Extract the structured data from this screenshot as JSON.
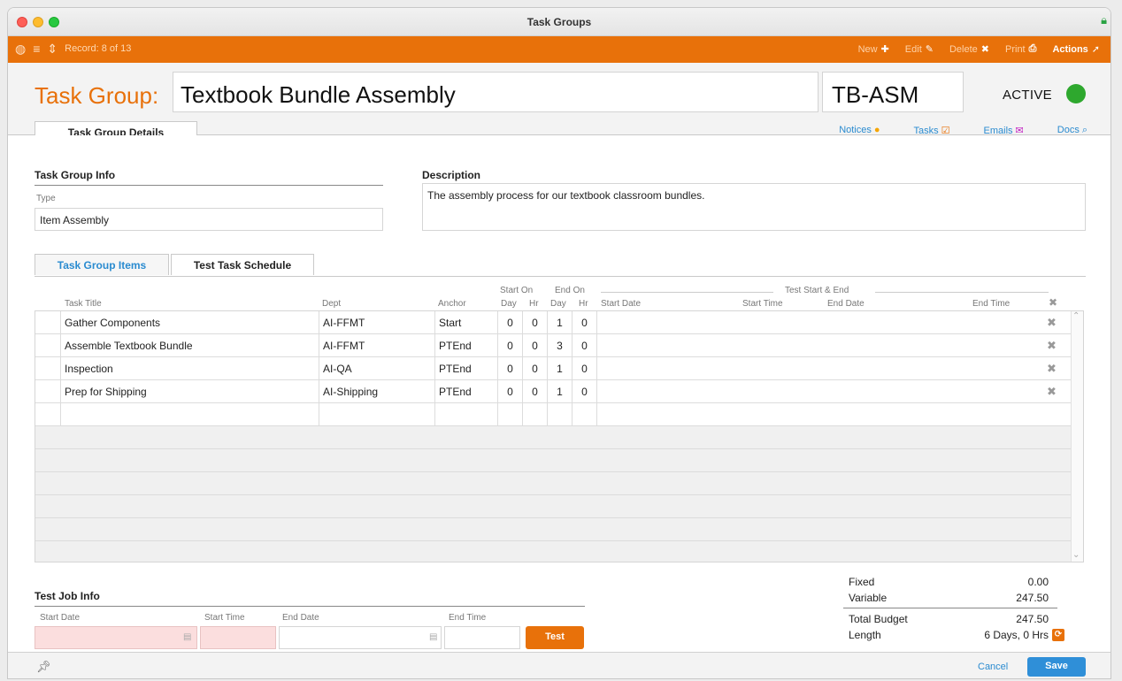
{
  "window": {
    "title": "Task Groups"
  },
  "toolbar": {
    "record": "Record: 8 of 13",
    "new_label": "New",
    "edit_label": "Edit",
    "delete_label": "Delete",
    "print_label": "Print",
    "actions_label": "Actions"
  },
  "header": {
    "label": "Task Group:",
    "name": "Textbook Bundle Assembly",
    "code": "TB-ASM",
    "status": "ACTIVE",
    "status_color": "#2ea82e",
    "main_tab": "Task Group Details",
    "links": {
      "notices": "Notices",
      "tasks": "Tasks",
      "emails": "Emails",
      "docs": "Docs"
    }
  },
  "info": {
    "title": "Task Group Info",
    "type_label": "Type",
    "type_value": "Item Assembly",
    "description_title": "Description",
    "description": "The assembly process for our textbook classroom bundles."
  },
  "subtabs": {
    "items": "Task Group Items",
    "schedule": "Test Task Schedule"
  },
  "grid": {
    "headers": {
      "task_title": "Task Title",
      "dept": "Dept",
      "anchor": "Anchor",
      "start_on": "Start On",
      "end_on": "End On",
      "day": "Day",
      "hr": "Hr",
      "test_start_end": "Test Start & End",
      "start_date": "Start Date",
      "start_time": "Start Time",
      "end_date": "End Date",
      "end_time": "End Time"
    },
    "rows": [
      {
        "title": "Gather Components",
        "dept": "AI-FFMT",
        "anchor": "Start",
        "sd": "0",
        "sh": "0",
        "ed": "1",
        "eh": "0"
      },
      {
        "title": "Assemble Textbook Bundle",
        "dept": "AI-FFMT",
        "anchor": "PTEnd",
        "sd": "0",
        "sh": "0",
        "ed": "3",
        "eh": "0"
      },
      {
        "title": "Inspection",
        "dept": "AI-QA",
        "anchor": "PTEnd",
        "sd": "0",
        "sh": "0",
        "ed": "1",
        "eh": "0"
      },
      {
        "title": "Prep for Shipping",
        "dept": "AI-Shipping",
        "anchor": "PTEnd",
        "sd": "0",
        "sh": "0",
        "ed": "1",
        "eh": "0"
      }
    ]
  },
  "test_job": {
    "title": "Test Job Info",
    "start_date_label": "Start Date",
    "start_time_label": "Start Time",
    "end_date_label": "End Date",
    "end_time_label": "End Time",
    "button": "Test"
  },
  "summary": {
    "fixed_label": "Fixed",
    "fixed": "0.00",
    "variable_label": "Variable",
    "variable": "247.50",
    "total_label": "Total Budget",
    "total": "247.50",
    "length_label": "Length",
    "length": "6 Days, 0 Hrs"
  },
  "footer": {
    "cancel": "Cancel",
    "save": "Save"
  },
  "colors": {
    "accent": "#e8710a",
    "link": "#2a8bd0",
    "save": "#2f8fd8"
  }
}
